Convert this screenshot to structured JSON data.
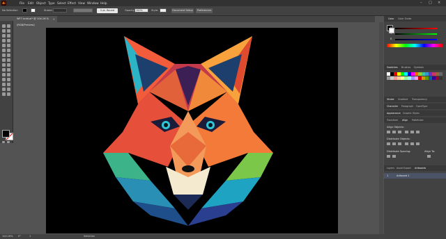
{
  "app": {
    "logo_text": "Ai"
  },
  "menu": [
    "File",
    "Edit",
    "Object",
    "Type",
    "Select",
    "Effect",
    "View",
    "Window",
    "Help"
  ],
  "controlbar": {
    "selection_label": "No Selection",
    "stroke_label": "Stroke:",
    "brush_label": "5 pt. Round",
    "opacity_label": "Opacity:",
    "opacity_value": "100%",
    "style_label": "Style:",
    "doc_setup_label": "Document Setup",
    "preferences_label": "Preferences"
  },
  "document_tab": {
    "title": "WF7.indd.ai* @ 104.16 % (RGB/Preview)"
  },
  "statusbar": {
    "zoom": "104.16%",
    "rotation": "0°",
    "page": "1",
    "tool": "Selection"
  },
  "colors": {
    "accent": "#ff9a00",
    "canvas_bg": "#000000",
    "ui_dark": "#424242"
  },
  "right_panel": {
    "color_tabs": [
      "Color",
      "Color Guide"
    ],
    "color_channels": [
      "R",
      "G",
      "B"
    ],
    "swatch_tabs": [
      "Swatches",
      "Brushes",
      "Symbols"
    ],
    "stroke_tabs": [
      "Stroke",
      "Gradient",
      "Transparency"
    ],
    "char_tabs": [
      "Character",
      "Paragraph",
      "OpenType"
    ],
    "appearance_tabs": [
      "Appearance",
      "Graphic Styles"
    ],
    "transform_tabs": [
      "Transform",
      "Align",
      "Pathfinder"
    ],
    "align_objects": "Align Objects:",
    "distribute_objects": "Distribute Objects:",
    "distribute_spacing": "Distribute Spacing:",
    "align_to": "Align To:",
    "layer_tabs": [
      "Layers",
      "Asset Export",
      "Artboards"
    ],
    "layer_item": "Artboard 1",
    "layer_number": "1"
  }
}
